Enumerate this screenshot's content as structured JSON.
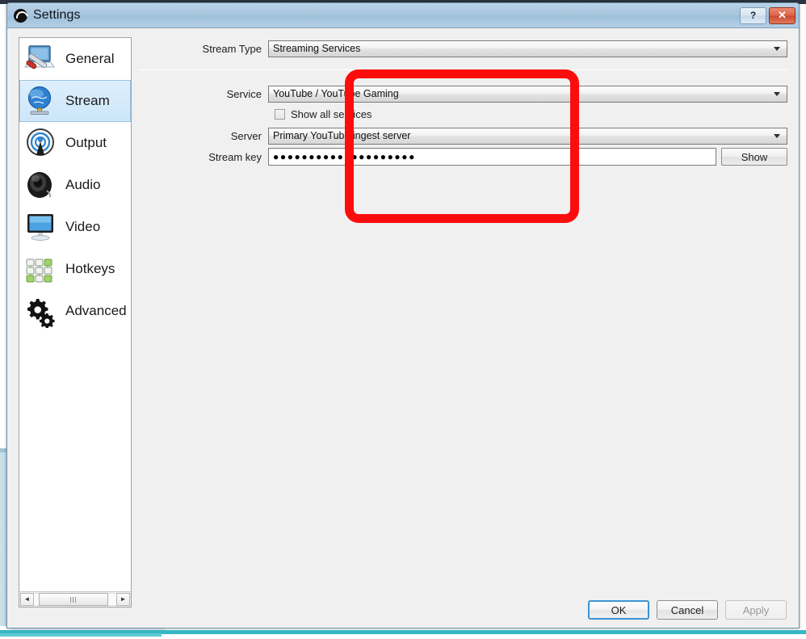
{
  "window": {
    "title": "Settings",
    "logo_icon": "obs-logo-icon",
    "help_label": "?",
    "close_label": "✕"
  },
  "sidebar": {
    "items": [
      {
        "label": "General",
        "icon": "general-icon",
        "selected": false
      },
      {
        "label": "Stream",
        "icon": "stream-icon",
        "selected": true
      },
      {
        "label": "Output",
        "icon": "output-icon",
        "selected": false
      },
      {
        "label": "Audio",
        "icon": "audio-icon",
        "selected": false
      },
      {
        "label": "Video",
        "icon": "video-icon",
        "selected": false
      },
      {
        "label": "Hotkeys",
        "icon": "hotkeys-icon",
        "selected": false
      },
      {
        "label": "Advanced",
        "icon": "advanced-icon",
        "selected": false
      }
    ],
    "scrollbar": {
      "left_arrow": "◄",
      "right_arrow": "►"
    }
  },
  "stream_form": {
    "stream_type": {
      "label": "Stream Type",
      "value": "Streaming Services"
    },
    "service": {
      "label": "Service",
      "value": "YouTube / YouTube Gaming"
    },
    "show_all_services": {
      "label": "Show all services",
      "checked": false
    },
    "server": {
      "label": "Server",
      "value": "Primary YouTube ingest server"
    },
    "stream_key": {
      "label": "Stream key",
      "value": "●●●●●●●●●●●●●●●●●●●●",
      "show_button_label": "Show"
    }
  },
  "footer": {
    "ok_label": "OK",
    "cancel_label": "Cancel",
    "apply_label": "Apply"
  },
  "annotation": {
    "color": "#fc0d0d",
    "shape": "rounded-rectangle"
  }
}
